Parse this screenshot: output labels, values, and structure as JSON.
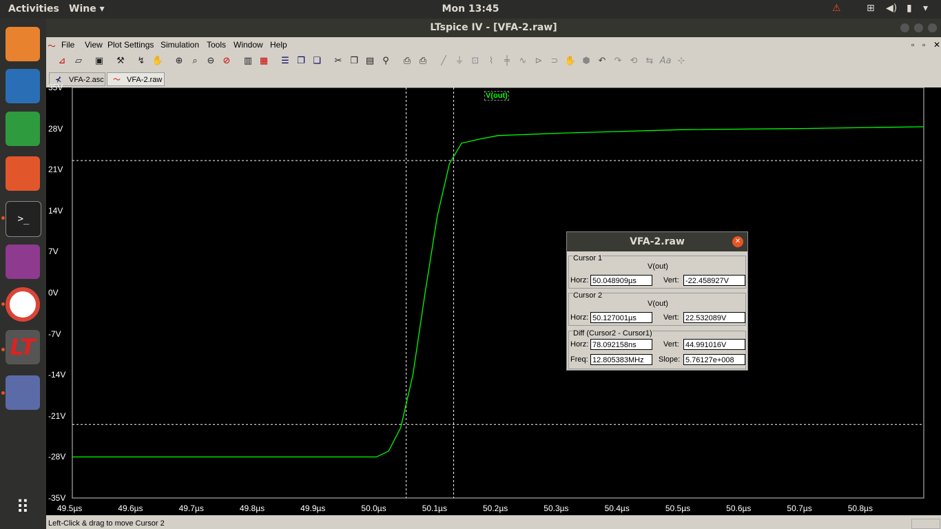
{
  "topbar": {
    "activities": "Activities",
    "app_menu": "Wine",
    "clock": "Mon 13:45"
  },
  "window": {
    "title": "LTspice IV - [VFA-2.raw]"
  },
  "menu": [
    "File",
    "View",
    "Plot Settings",
    "Simulation",
    "Tools",
    "Window",
    "Help"
  ],
  "tabs": [
    {
      "label": "VFA-2.asc"
    },
    {
      "label": "VFA-2.raw"
    }
  ],
  "plot": {
    "trace_label": "V(out)",
    "y_ticks": [
      "35V",
      "28V",
      "21V",
      "14V",
      "7V",
      "0V",
      "-7V",
      "-14V",
      "-21V",
      "-28V",
      "-35V"
    ],
    "x_ticks": [
      "49.5µs",
      "49.6µs",
      "49.7µs",
      "49.8µs",
      "49.9µs",
      "50.0µs",
      "50.1µs",
      "50.2µs",
      "50.3µs",
      "50.4µs",
      "50.5µs",
      "50.6µs",
      "50.7µs",
      "50.8µs"
    ]
  },
  "chart_data": {
    "type": "line",
    "series": [
      {
        "name": "V(out)",
        "x": [
          49.5,
          50.0,
          50.02,
          50.04,
          50.06,
          50.08,
          50.1,
          50.12,
          50.14,
          50.17,
          50.2,
          50.3,
          50.5,
          50.7,
          50.9
        ],
        "y": [
          -28,
          -28,
          -27,
          -23,
          -14,
          0,
          13,
          22,
          25.5,
          26.2,
          26.8,
          27.2,
          27.8,
          28.0,
          28.3
        ]
      }
    ],
    "xlim": [
      49.5,
      50.9
    ],
    "ylim": [
      -35,
      35
    ],
    "cursors": {
      "x1": 50.048909,
      "x2": 50.127001,
      "y1": -22.458927,
      "y2": 22.532089
    },
    "color": "#00ff00"
  },
  "dialog": {
    "title": "VFA-2.raw",
    "cursor1": {
      "label": "Cursor 1",
      "trace": "V(out)",
      "horz_label": "Horz:",
      "horz": "50.048909µs",
      "vert_label": "Vert:",
      "vert": "-22.458927V"
    },
    "cursor2": {
      "label": "Cursor 2",
      "trace": "V(out)",
      "horz_label": "Horz:",
      "horz": "50.127001µs",
      "vert_label": "Vert:",
      "vert": "22.532089V"
    },
    "diff": {
      "label": "Diff (Cursor2 - Cursor1)",
      "horz_label": "Horz:",
      "horz": "78.092158ns",
      "vert_label": "Vert:",
      "vert": "44.991016V",
      "freq_label": "Freq:",
      "freq": "12.805383MHz",
      "slope_label": "Slope:",
      "slope": "5.76127e+008"
    }
  },
  "status": "Left-Click & drag to move Cursor 2"
}
